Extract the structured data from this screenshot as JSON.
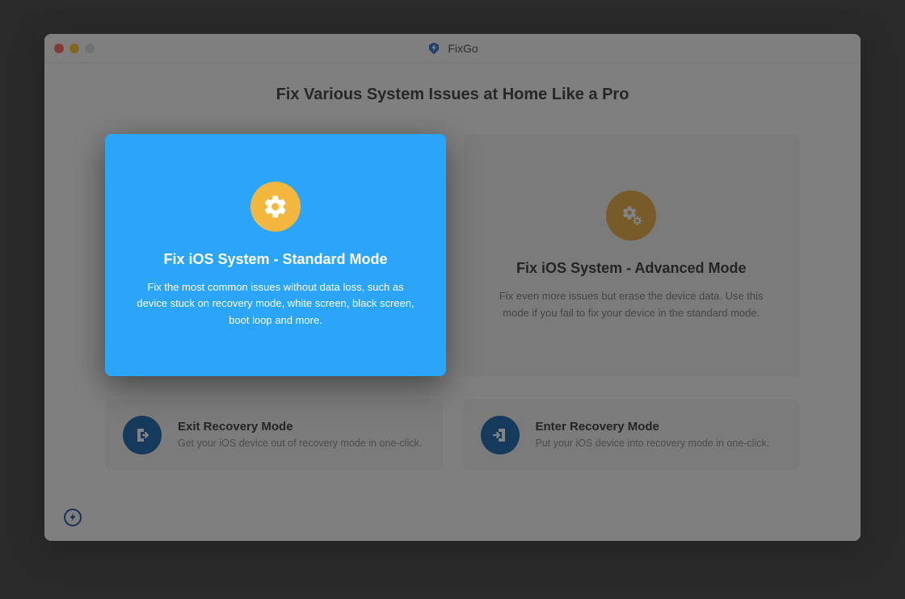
{
  "app": {
    "title": "FixGo"
  },
  "headline": "Fix Various System Issues at Home Like a Pro",
  "cards": {
    "standard": {
      "title": "Fix iOS System - Standard Mode",
      "desc": "Fix the most common issues without data loss, such as device stuck on recovery mode, white screen, black screen, boot loop and more."
    },
    "advanced": {
      "title": "Fix iOS System - Advanced Mode",
      "desc": "Fix even more issues but erase the device data. Use this mode if you fail to fix your device in the standard mode."
    },
    "exit": {
      "title": "Exit Recovery Mode",
      "desc": "Get your iOS device out of recovery mode in one-click."
    },
    "enter": {
      "title": "Enter Recovery Mode",
      "desc": "Put your iOS device into recovery mode in one-click."
    }
  }
}
